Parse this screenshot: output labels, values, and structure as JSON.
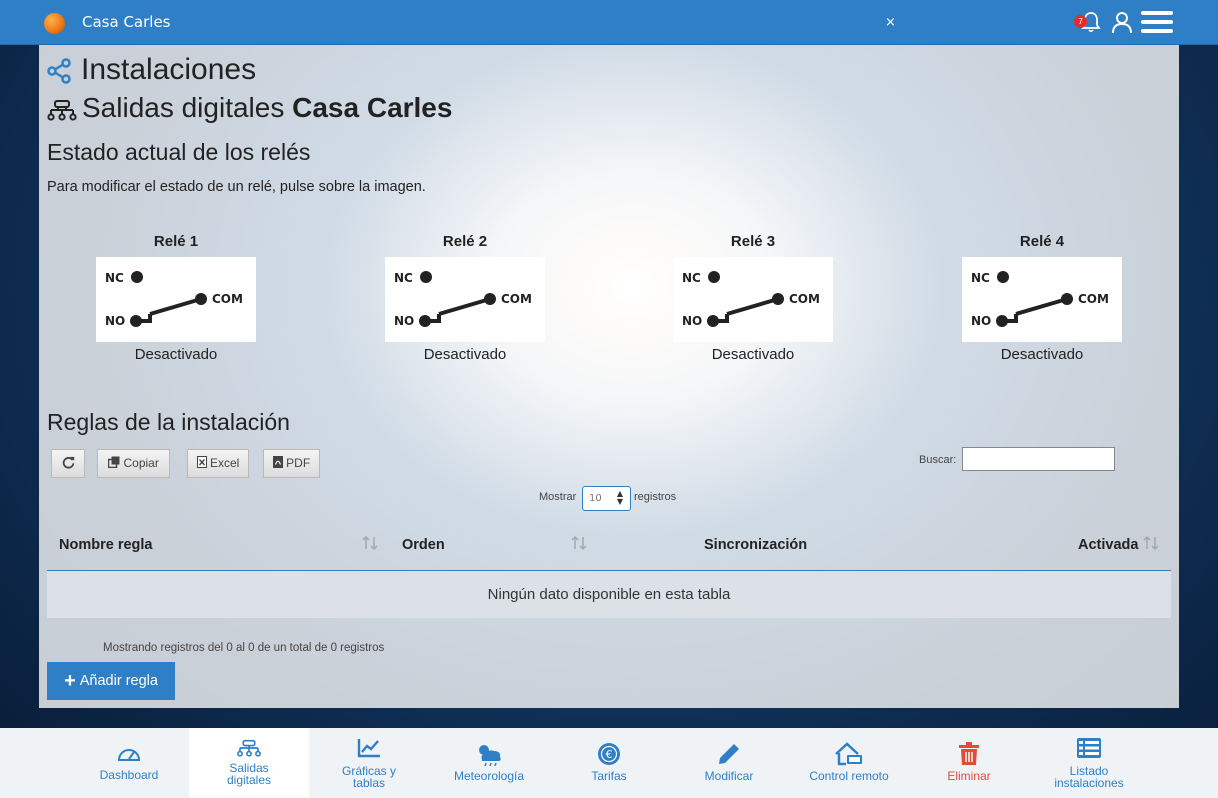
{
  "header": {
    "app_title": "Casa Carles",
    "close_symbol": "×",
    "notification_count": "7"
  },
  "page": {
    "title": "Instalaciones",
    "subtitle_prefix": "Salidas digitales",
    "subtitle_name": "Casa Carles",
    "relay_section_title": "Estado actual de los relés",
    "relay_hint": "Para modificar el estado de un relé, pulse sobre la imagen.",
    "rules_section_title": "Reglas de la instalación"
  },
  "relay_labels": {
    "nc": "NC",
    "no": "NO",
    "com": "COM"
  },
  "relays": [
    {
      "name": "Relé 1",
      "state": "Desactivado"
    },
    {
      "name": "Relé 2",
      "state": "Desactivado"
    },
    {
      "name": "Relé 3",
      "state": "Desactivado"
    },
    {
      "name": "Relé 4",
      "state": "Desactivado"
    }
  ],
  "table_tools": {
    "copy": "Copiar",
    "excel": "Excel",
    "pdf": "PDF",
    "search_label": "Buscar:",
    "search_value": "",
    "show_label": "Mostrar",
    "show_value": "10",
    "records_label": "registros"
  },
  "table": {
    "columns": [
      "Nombre regla",
      "Orden",
      "Sincronización",
      "Activada"
    ],
    "empty_message": "Ningún dato disponible en esta tabla",
    "info": "Mostrando registros del 0 al 0 de un total de 0 registros"
  },
  "add_rule_label": "Añadir regla",
  "bottom_nav": [
    {
      "label": "Dashboard",
      "icon": "gauge-icon"
    },
    {
      "label": "Salidas digitales",
      "icon": "relay-outputs-icon"
    },
    {
      "label": "Gráficas y tablas",
      "icon": "line-chart-icon"
    },
    {
      "label": "Meteorología",
      "icon": "weather-icon"
    },
    {
      "label": "Tarifas",
      "icon": "euro-icon"
    },
    {
      "label": "Modificar",
      "icon": "pencil-icon"
    },
    {
      "label": "Control remoto",
      "icon": "remote-home-icon"
    },
    {
      "label": "Eliminar",
      "icon": "trash-icon"
    },
    {
      "label": "Listado instalaciones",
      "icon": "list-icon"
    }
  ],
  "colors": {
    "primary": "#2f7fc6",
    "danger": "#e24b3a",
    "badge": "#e02c2c"
  }
}
